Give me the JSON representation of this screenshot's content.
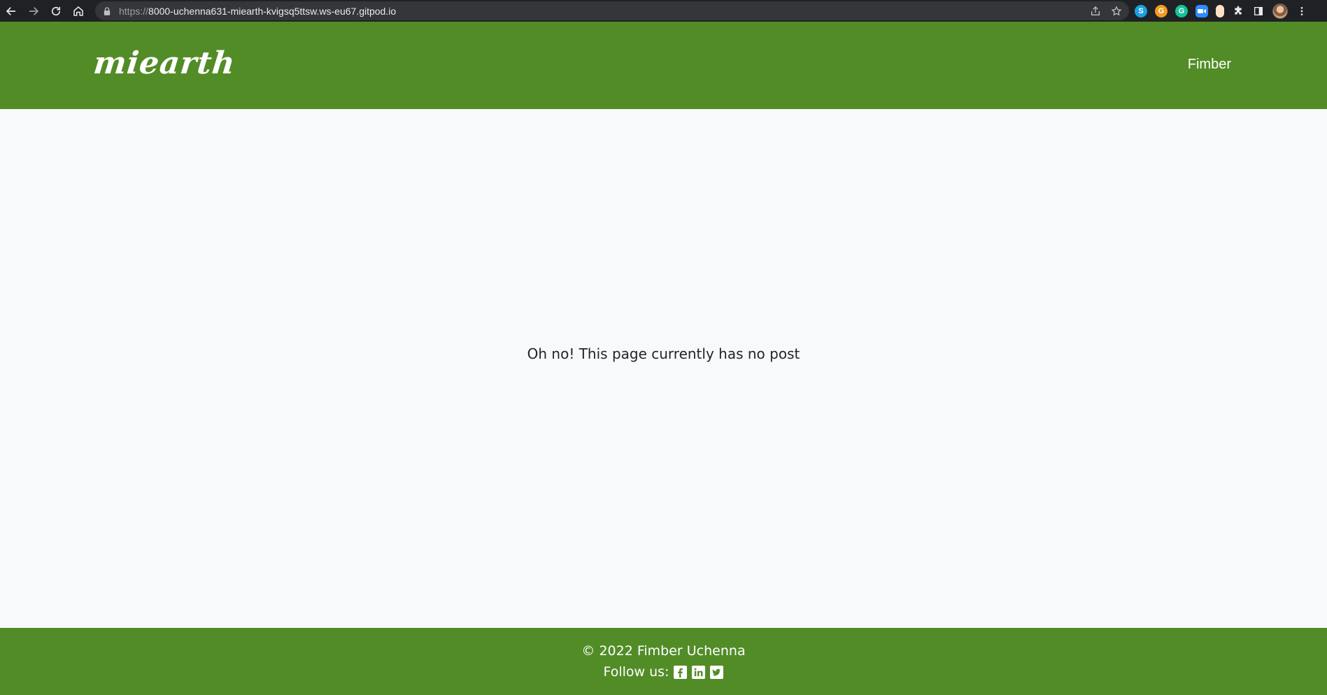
{
  "browser": {
    "url_scheme": "https://",
    "url_host": "8000-uchenna631-miearth-kvigsq5ttsw.ws-eu67.gitpod.io",
    "extensions": {
      "skype_letter": "S",
      "gram_letter": "G",
      "grammarly_letter": "G"
    }
  },
  "header": {
    "brand": "miearth",
    "nav_user": "Fimber"
  },
  "main": {
    "empty_message": "Oh no! This page currently has no post"
  },
  "footer": {
    "copyright": "© 2022 Fimber Uchenna",
    "follow_label": "Follow us:",
    "social_icons": [
      "facebook-icon",
      "linkedin-icon",
      "twitter-icon"
    ]
  },
  "colors": {
    "brand_green": "#528c27",
    "page_bg": "#f8f9fa",
    "text_dark": "#212529"
  }
}
